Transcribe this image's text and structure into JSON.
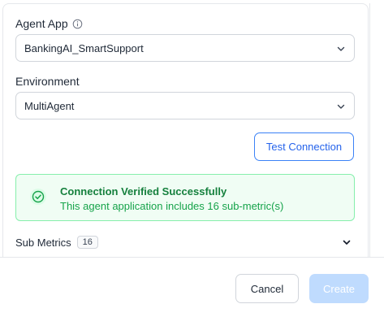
{
  "agent_app": {
    "label": "Agent App",
    "value": "BankingAI_SmartSupport",
    "info_icon": "info-circle-icon"
  },
  "environment": {
    "label": "Environment",
    "value": "MultiAgent"
  },
  "test_connection": {
    "label": "Test Connection"
  },
  "success": {
    "title": "Connection Verified Successfully",
    "message": "This agent application includes 16 sub-metric(s)",
    "icon": "check-circle-icon",
    "color": "#15803d"
  },
  "sub_metrics": {
    "label": "Sub Metrics",
    "count": "16"
  },
  "footer": {
    "cancel_label": "Cancel",
    "create_label": "Create"
  },
  "colors": {
    "accent": "#2563eb",
    "success_bg": "#f0fdf4",
    "disabled_primary": "#bfdbfe"
  }
}
